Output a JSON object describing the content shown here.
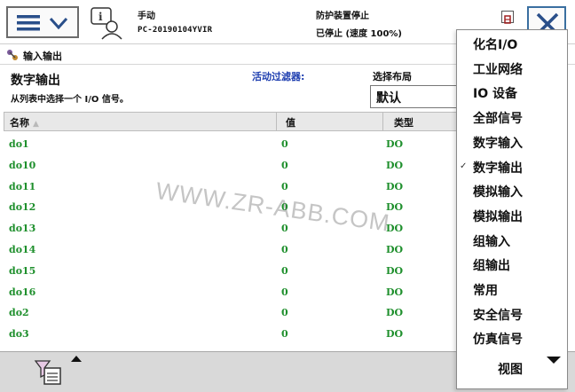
{
  "status": {
    "mode": "手动",
    "controller": "PC-20190104YVIR",
    "state": "防护装置停止",
    "speed": "已停止 (速度 100%)"
  },
  "breadcrumb": {
    "label": "输入输出"
  },
  "view": {
    "title": "数字输出",
    "subtitle": "从列表中选择一个 I/O 信号。",
    "filter_label": "活动过滤器:",
    "layout_label": "选择布局",
    "layout_value": "默认"
  },
  "table": {
    "headers": {
      "name": "名称",
      "value": "值",
      "type": "类型"
    },
    "rows": [
      {
        "name": "do1",
        "value": "0",
        "type": "DO"
      },
      {
        "name": "do10",
        "value": "0",
        "type": "DO"
      },
      {
        "name": "do11",
        "value": "0",
        "type": "DO"
      },
      {
        "name": "do12",
        "value": "0",
        "type": "DO"
      },
      {
        "name": "do13",
        "value": "0",
        "type": "DO"
      },
      {
        "name": "do14",
        "value": "0",
        "type": "DO"
      },
      {
        "name": "do15",
        "value": "0",
        "type": "DO"
      },
      {
        "name": "do16",
        "value": "0",
        "type": "DO"
      },
      {
        "name": "do2",
        "value": "0",
        "type": "DO"
      },
      {
        "name": "do3",
        "value": "0",
        "type": "DO"
      }
    ]
  },
  "menu": {
    "items": [
      {
        "label": "化名I/O",
        "checked": false
      },
      {
        "label": "工业网络",
        "checked": false
      },
      {
        "label": "IO 设备",
        "checked": false
      },
      {
        "label": "全部信号",
        "checked": false
      },
      {
        "label": "数字输入",
        "checked": false
      },
      {
        "label": "数字输出",
        "checked": true
      },
      {
        "label": "模拟输入",
        "checked": false
      },
      {
        "label": "模拟输出",
        "checked": false
      },
      {
        "label": "组输入",
        "checked": false
      },
      {
        "label": "组输出",
        "checked": false
      },
      {
        "label": "常用",
        "checked": false
      },
      {
        "label": "安全信号",
        "checked": false
      },
      {
        "label": "仿真信号",
        "checked": false
      }
    ],
    "view_label": "视图",
    "check_glyph": "✓"
  },
  "watermark": "WWW.ZR-ABB.COM",
  "colors": {
    "signal_text": "#1e8f2c",
    "filter_label": "#1f3fb0",
    "bottom_bar": "#d9d9d9"
  },
  "icons": {
    "menu_button": "hamburger-chevron-icon",
    "status": "operator-info-icon",
    "close": "close-icon",
    "breadcrumb": "io-icon",
    "filter": "filter-icon"
  }
}
